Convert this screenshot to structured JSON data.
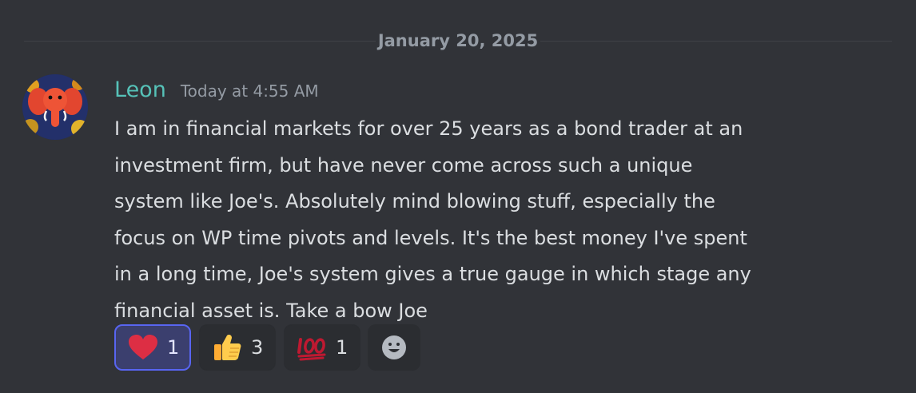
{
  "divider": {
    "date": "January 20, 2025"
  },
  "message": {
    "author": "Leon",
    "timestamp": "Today at 4:55 AM",
    "lines": [
      "I am in financial markets for over 25 years as a bond trader at an",
      "investment firm, but have never come across such a unique",
      "system like Joe's. Absolutely mind blowing stuff, especially the",
      "focus on WP time pivots and levels. It's the best money I've spent",
      "in a long time, Joe's system gives a true gauge in which stage any",
      "financial asset is. Take a bow Joe"
    ]
  },
  "reactions": [
    {
      "emoji": "heart-icon",
      "count": "1",
      "active": true
    },
    {
      "emoji": "thumbs-up-icon",
      "count": "3",
      "active": false
    },
    {
      "emoji": "hundred-points-icon",
      "count": "1",
      "active": false
    }
  ],
  "colors": {
    "background": "#313338",
    "username": "#56c2b8",
    "muted": "#949ba4",
    "text": "#dbdee1",
    "accent": "#5865f2"
  }
}
